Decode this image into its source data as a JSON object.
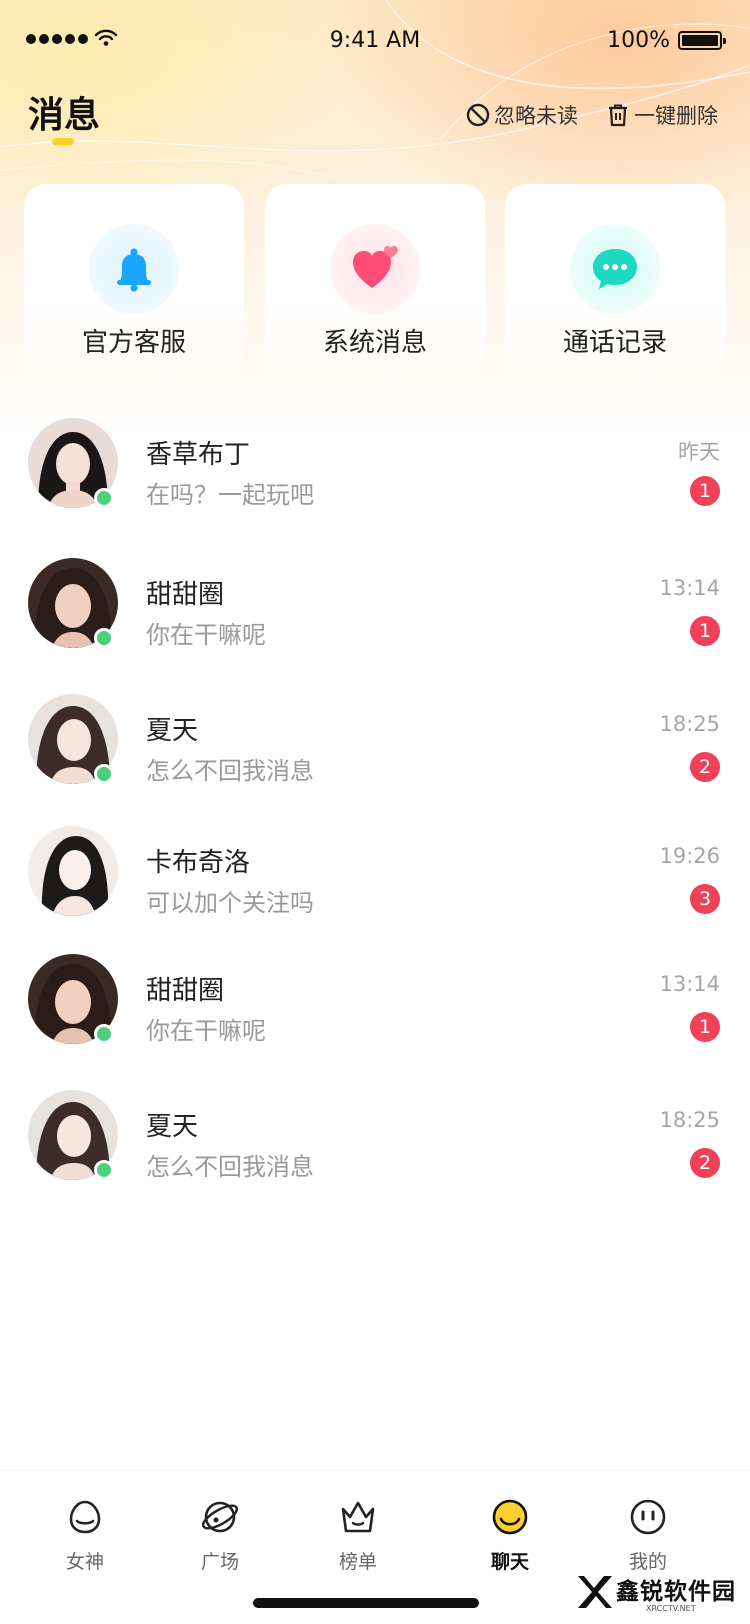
{
  "status_bar": {
    "time": "9:41 AM",
    "battery": "100%"
  },
  "header": {
    "title": "消息",
    "ignore_unread": "忽略未读",
    "delete_all": "一键删除"
  },
  "quick_cards": [
    {
      "label": "官方客服",
      "icon": "bell-icon",
      "color": "#1aa6ff"
    },
    {
      "label": "系统消息",
      "icon": "heart-icon",
      "color": "#ff4d75"
    },
    {
      "label": "通话记录",
      "icon": "chat-bubble-icon",
      "color": "#1ed8c4"
    }
  ],
  "conversations": [
    {
      "name": "香草布丁",
      "message": "在吗？一起玩吧",
      "time": "昨天",
      "unread": "1",
      "online": true
    },
    {
      "name": "甜甜圈",
      "message": "你在干嘛呢",
      "time": "13:14",
      "unread": "1",
      "online": true
    },
    {
      "name": "夏天",
      "message": "怎么不回我消息",
      "time": "18:25",
      "unread": "2",
      "online": true
    },
    {
      "name": "卡布奇洛",
      "message": "可以加个关注吗",
      "time": "19:26",
      "unread": "3",
      "online": false
    },
    {
      "name": "甜甜圈",
      "message": "你在干嘛呢",
      "time": "13:14",
      "unread": "1",
      "online": true
    },
    {
      "name": "夏天",
      "message": "怎么不回我消息",
      "time": "18:25",
      "unread": "2",
      "online": true
    }
  ],
  "tab_bar": [
    {
      "label": "女神",
      "icon": "goddess-icon",
      "active": false
    },
    {
      "label": "广场",
      "icon": "planet-icon",
      "active": false
    },
    {
      "label": "榜单",
      "icon": "crown-icon",
      "active": false
    },
    {
      "label": "聊天",
      "icon": "smile-chat-icon",
      "active": true
    },
    {
      "label": "我的",
      "icon": "profile-face-icon",
      "active": false
    }
  ],
  "watermark": {
    "text": "鑫锐软件园",
    "sub": "XRCCTV.NET"
  },
  "colors": {
    "accent": "#ffcf2d",
    "badge": "#f0405a",
    "online": "#4cd07d"
  }
}
